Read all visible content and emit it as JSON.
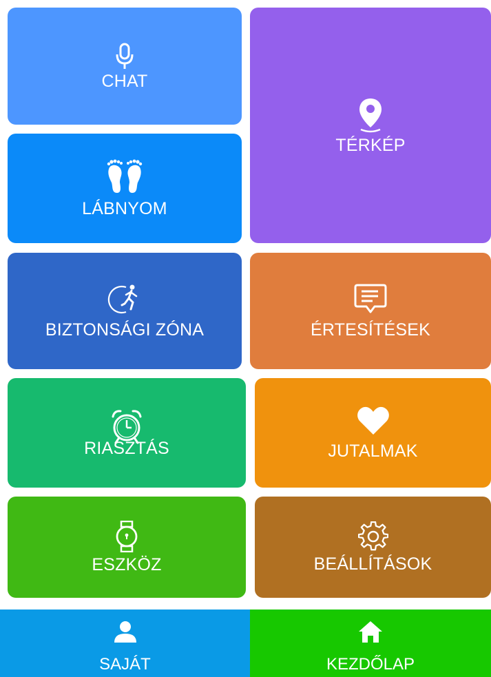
{
  "tiles": {
    "chat": {
      "label": "CHAT",
      "icon": "microphone-icon",
      "color": "#4D96FF"
    },
    "map": {
      "label": "TÉRKÉP",
      "icon": "location-pin-icon",
      "color": "#9460EC"
    },
    "footprint": {
      "label": "LÁBNYOM",
      "icon": "footprints-icon",
      "color": "#0B8AF9"
    },
    "safe_zone": {
      "label": "BIZTONSÁGI ZÓNA",
      "icon": "running-person-icon",
      "color": "#2F67C8"
    },
    "notifications": {
      "label": "ÉRTESÍTÉSEK",
      "icon": "message-icon",
      "color": "#E07D3D"
    },
    "alarm": {
      "label": "RIASZTÁS",
      "icon": "alarm-clock-icon",
      "color": "#17BA6E"
    },
    "rewards": {
      "label": "JUTALMAK",
      "icon": "heart-icon",
      "color": "#F0920D"
    },
    "device": {
      "label": "ESZKÖZ",
      "icon": "watch-icon",
      "color": "#40B914"
    },
    "settings": {
      "label": "BEÁLLÍTÁSOK",
      "icon": "gear-icon",
      "color": "#B07022"
    }
  },
  "nav": {
    "profile": {
      "label": "SAJÁT",
      "icon": "person-icon",
      "color": "#0A9AE6"
    },
    "home": {
      "label": "KEZDŐLAP",
      "icon": "home-icon",
      "color": "#17C800"
    }
  }
}
